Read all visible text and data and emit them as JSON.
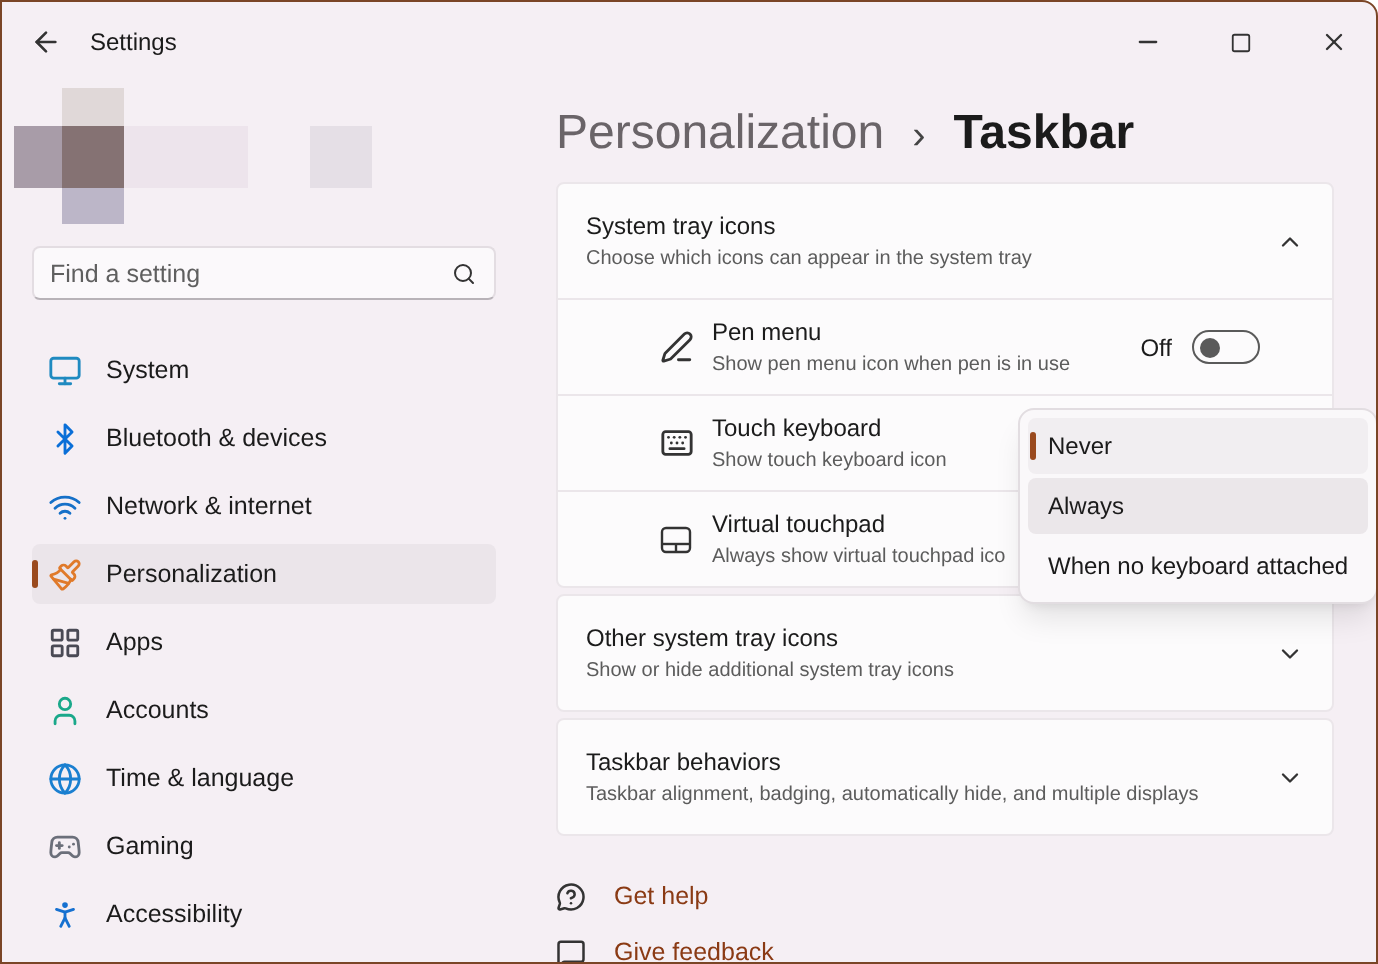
{
  "window": {
    "title": "Settings"
  },
  "search": {
    "placeholder": "Find a setting"
  },
  "nav": [
    {
      "label": "System",
      "selected": false
    },
    {
      "label": "Bluetooth & devices",
      "selected": false
    },
    {
      "label": "Network & internet",
      "selected": false
    },
    {
      "label": "Personalization",
      "selected": true
    },
    {
      "label": "Apps",
      "selected": false
    },
    {
      "label": "Accounts",
      "selected": false
    },
    {
      "label": "Time & language",
      "selected": false
    },
    {
      "label": "Gaming",
      "selected": false
    },
    {
      "label": "Accessibility",
      "selected": false
    }
  ],
  "breadcrumb": {
    "parent": "Personalization",
    "separator": "›",
    "current": "Taskbar"
  },
  "cards": [
    {
      "title": "System tray icons",
      "description": "Choose which icons can appear in the system tray",
      "expanded": true,
      "rows": [
        {
          "kind": "toggle",
          "title": "Pen menu",
          "description": "Show pen menu icon when pen is in use",
          "value": "Off",
          "on": false
        },
        {
          "kind": "dropdown",
          "title": "Touch keyboard",
          "description": "Show touch keyboard icon"
        },
        {
          "kind": "dropdown",
          "title": "Virtual touchpad",
          "description": "Always show virtual touchpad ico"
        }
      ]
    },
    {
      "title": "Other system tray icons",
      "description": "Show or hide additional system tray icons",
      "expanded": false
    },
    {
      "title": "Taskbar behaviors",
      "description": "Taskbar alignment, badging, automatically hide, and multiple displays",
      "expanded": false
    }
  ],
  "dropdown_menu": {
    "options": [
      {
        "label": "Never",
        "selected": true,
        "hovered": false
      },
      {
        "label": "Always",
        "selected": false,
        "hovered": true
      },
      {
        "label": "When no keyboard attached",
        "selected": false,
        "hovered": false
      }
    ]
  },
  "links": [
    "Get help",
    "Give feedback"
  ]
}
